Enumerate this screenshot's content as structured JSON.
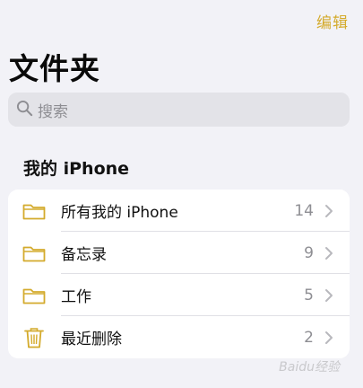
{
  "header": {
    "edit_label": "编辑",
    "title": "文件夹"
  },
  "search": {
    "placeholder": "搜索",
    "icon": "magnifying-glass-icon"
  },
  "section": {
    "title": "我的 iPhone"
  },
  "folders": [
    {
      "label": "所有我的 iPhone",
      "count": "14",
      "icon": "folder-icon"
    },
    {
      "label": "备忘录",
      "count": "9",
      "icon": "folder-icon"
    },
    {
      "label": "工作",
      "count": "5",
      "icon": "folder-icon"
    },
    {
      "label": "最近删除",
      "count": "2",
      "icon": "trash-icon"
    }
  ],
  "colors": {
    "accent": "#d4ab2d",
    "background": "#f2f2f7",
    "secondary_text": "#8e8e93"
  },
  "watermark": {
    "text": "Baidu经验"
  }
}
